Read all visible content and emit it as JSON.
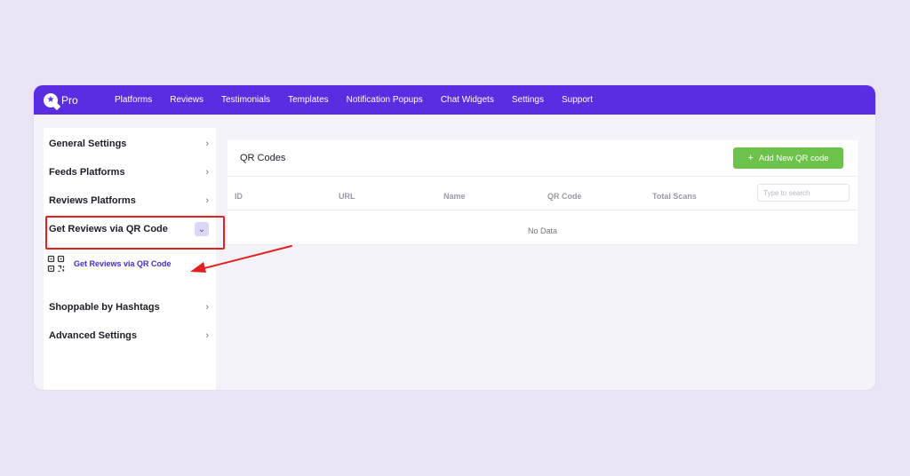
{
  "app": {
    "name": "Pro"
  },
  "nav": {
    "items": [
      "Platforms",
      "Reviews",
      "Testimonials",
      "Templates",
      "Notification Popups",
      "Chat Widgets",
      "Settings",
      "Support"
    ]
  },
  "sidebar": {
    "items": [
      {
        "label": "General Settings"
      },
      {
        "label": "Feeds Platforms"
      },
      {
        "label": "Reviews Platforms"
      },
      {
        "label": "Get Reviews via QR Code",
        "expanded": true
      },
      {
        "label": "Shoppable by Hashtags"
      },
      {
        "label": "Advanced Settings"
      }
    ],
    "sub_item": {
      "label": "Get Reviews via QR Code",
      "icon": "qr-code-icon"
    }
  },
  "main": {
    "title": "QR Codes",
    "add_button": "Add New QR code",
    "columns": [
      "ID",
      "URL",
      "Name",
      "QR Code",
      "Total Scans"
    ],
    "search_placeholder": "Type to search",
    "empty_text": "No Data"
  },
  "colors": {
    "accent": "#5a2de0",
    "button": "#6cc24a",
    "highlight": "#e32020"
  }
}
